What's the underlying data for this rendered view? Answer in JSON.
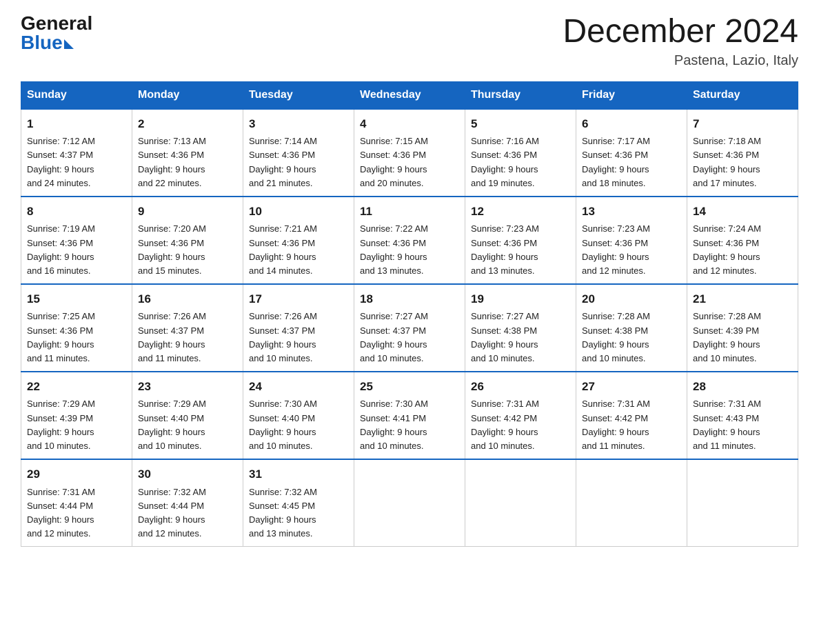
{
  "header": {
    "logo_general": "General",
    "logo_blue": "Blue",
    "title": "December 2024",
    "subtitle": "Pastena, Lazio, Italy"
  },
  "columns": [
    "Sunday",
    "Monday",
    "Tuesday",
    "Wednesday",
    "Thursday",
    "Friday",
    "Saturday"
  ],
  "weeks": [
    [
      {
        "day": "1",
        "sunrise": "7:12 AM",
        "sunset": "4:37 PM",
        "daylight": "9 hours and 24 minutes."
      },
      {
        "day": "2",
        "sunrise": "7:13 AM",
        "sunset": "4:36 PM",
        "daylight": "9 hours and 22 minutes."
      },
      {
        "day": "3",
        "sunrise": "7:14 AM",
        "sunset": "4:36 PM",
        "daylight": "9 hours and 21 minutes."
      },
      {
        "day": "4",
        "sunrise": "7:15 AM",
        "sunset": "4:36 PM",
        "daylight": "9 hours and 20 minutes."
      },
      {
        "day": "5",
        "sunrise": "7:16 AM",
        "sunset": "4:36 PM",
        "daylight": "9 hours and 19 minutes."
      },
      {
        "day": "6",
        "sunrise": "7:17 AM",
        "sunset": "4:36 PM",
        "daylight": "9 hours and 18 minutes."
      },
      {
        "day": "7",
        "sunrise": "7:18 AM",
        "sunset": "4:36 PM",
        "daylight": "9 hours and 17 minutes."
      }
    ],
    [
      {
        "day": "8",
        "sunrise": "7:19 AM",
        "sunset": "4:36 PM",
        "daylight": "9 hours and 16 minutes."
      },
      {
        "day": "9",
        "sunrise": "7:20 AM",
        "sunset": "4:36 PM",
        "daylight": "9 hours and 15 minutes."
      },
      {
        "day": "10",
        "sunrise": "7:21 AM",
        "sunset": "4:36 PM",
        "daylight": "9 hours and 14 minutes."
      },
      {
        "day": "11",
        "sunrise": "7:22 AM",
        "sunset": "4:36 PM",
        "daylight": "9 hours and 13 minutes."
      },
      {
        "day": "12",
        "sunrise": "7:23 AM",
        "sunset": "4:36 PM",
        "daylight": "9 hours and 13 minutes."
      },
      {
        "day": "13",
        "sunrise": "7:23 AM",
        "sunset": "4:36 PM",
        "daylight": "9 hours and 12 minutes."
      },
      {
        "day": "14",
        "sunrise": "7:24 AM",
        "sunset": "4:36 PM",
        "daylight": "9 hours and 12 minutes."
      }
    ],
    [
      {
        "day": "15",
        "sunrise": "7:25 AM",
        "sunset": "4:36 PM",
        "daylight": "9 hours and 11 minutes."
      },
      {
        "day": "16",
        "sunrise": "7:26 AM",
        "sunset": "4:37 PM",
        "daylight": "9 hours and 11 minutes."
      },
      {
        "day": "17",
        "sunrise": "7:26 AM",
        "sunset": "4:37 PM",
        "daylight": "9 hours and 10 minutes."
      },
      {
        "day": "18",
        "sunrise": "7:27 AM",
        "sunset": "4:37 PM",
        "daylight": "9 hours and 10 minutes."
      },
      {
        "day": "19",
        "sunrise": "7:27 AM",
        "sunset": "4:38 PM",
        "daylight": "9 hours and 10 minutes."
      },
      {
        "day": "20",
        "sunrise": "7:28 AM",
        "sunset": "4:38 PM",
        "daylight": "9 hours and 10 minutes."
      },
      {
        "day": "21",
        "sunrise": "7:28 AM",
        "sunset": "4:39 PM",
        "daylight": "9 hours and 10 minutes."
      }
    ],
    [
      {
        "day": "22",
        "sunrise": "7:29 AM",
        "sunset": "4:39 PM",
        "daylight": "9 hours and 10 minutes."
      },
      {
        "day": "23",
        "sunrise": "7:29 AM",
        "sunset": "4:40 PM",
        "daylight": "9 hours and 10 minutes."
      },
      {
        "day": "24",
        "sunrise": "7:30 AM",
        "sunset": "4:40 PM",
        "daylight": "9 hours and 10 minutes."
      },
      {
        "day": "25",
        "sunrise": "7:30 AM",
        "sunset": "4:41 PM",
        "daylight": "9 hours and 10 minutes."
      },
      {
        "day": "26",
        "sunrise": "7:31 AM",
        "sunset": "4:42 PM",
        "daylight": "9 hours and 10 minutes."
      },
      {
        "day": "27",
        "sunrise": "7:31 AM",
        "sunset": "4:42 PM",
        "daylight": "9 hours and 11 minutes."
      },
      {
        "day": "28",
        "sunrise": "7:31 AM",
        "sunset": "4:43 PM",
        "daylight": "9 hours and 11 minutes."
      }
    ],
    [
      {
        "day": "29",
        "sunrise": "7:31 AM",
        "sunset": "4:44 PM",
        "daylight": "9 hours and 12 minutes."
      },
      {
        "day": "30",
        "sunrise": "7:32 AM",
        "sunset": "4:44 PM",
        "daylight": "9 hours and 12 minutes."
      },
      {
        "day": "31",
        "sunrise": "7:32 AM",
        "sunset": "4:45 PM",
        "daylight": "9 hours and 13 minutes."
      },
      null,
      null,
      null,
      null
    ]
  ],
  "labels": {
    "sunrise": "Sunrise:",
    "sunset": "Sunset:",
    "daylight": "Daylight:"
  }
}
